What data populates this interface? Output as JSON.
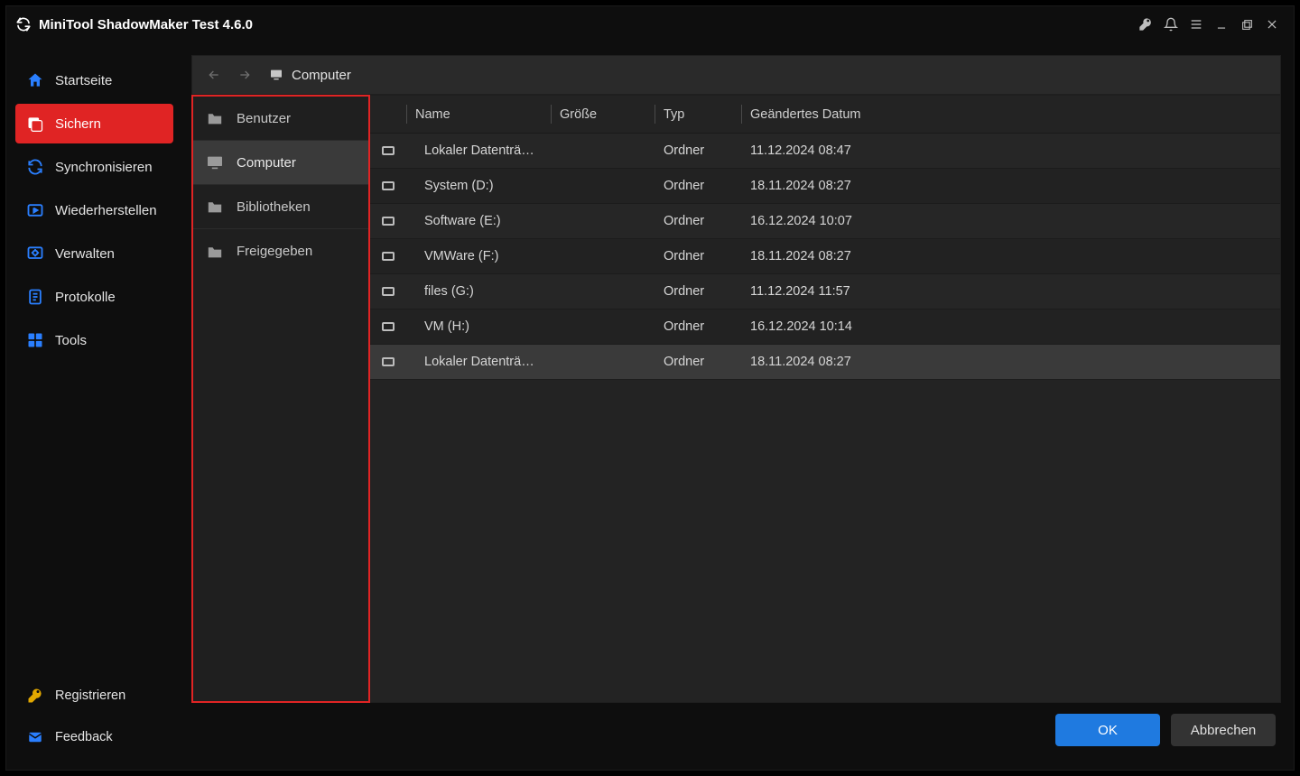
{
  "window": {
    "title": "MiniTool ShadowMaker Test 4.6.0"
  },
  "sidebar": {
    "items": [
      {
        "label": "Startseite"
      },
      {
        "label": "Sichern"
      },
      {
        "label": "Synchronisieren"
      },
      {
        "label": "Wiederherstellen"
      },
      {
        "label": "Verwalten"
      },
      {
        "label": "Protokolle"
      },
      {
        "label": "Tools"
      }
    ],
    "active_index": 1,
    "bottom": [
      {
        "label": "Registrieren"
      },
      {
        "label": "Feedback"
      }
    ]
  },
  "breadcrumb": {
    "location": "Computer"
  },
  "tree": {
    "items": [
      {
        "label": "Benutzer"
      },
      {
        "label": "Computer"
      },
      {
        "label": "Bibliotheken"
      },
      {
        "label": "Freigegeben"
      }
    ],
    "selected_index": 1
  },
  "columns": {
    "name": "Name",
    "size": "Größe",
    "type": "Typ",
    "date": "Geändertes Datum"
  },
  "rows": [
    {
      "name": "Lokaler Datenträ…",
      "size": "",
      "type": "Ordner",
      "date": "11.12.2024 08:47"
    },
    {
      "name": "System (D:)",
      "size": "",
      "type": "Ordner",
      "date": "18.11.2024 08:27"
    },
    {
      "name": "Software (E:)",
      "size": "",
      "type": "Ordner",
      "date": "16.12.2024 10:07"
    },
    {
      "name": "VMWare (F:)",
      "size": "",
      "type": "Ordner",
      "date": "18.11.2024 08:27"
    },
    {
      "name": "files (G:)",
      "size": "",
      "type": "Ordner",
      "date": "11.12.2024 11:57"
    },
    {
      "name": "VM (H:)",
      "size": "",
      "type": "Ordner",
      "date": "16.12.2024 10:14"
    },
    {
      "name": "Lokaler Datenträ…",
      "size": "",
      "type": "Ordner",
      "date": "18.11.2024 08:27"
    }
  ],
  "hover_row_index": 6,
  "footer": {
    "ok": "OK",
    "cancel": "Abbrechen"
  }
}
